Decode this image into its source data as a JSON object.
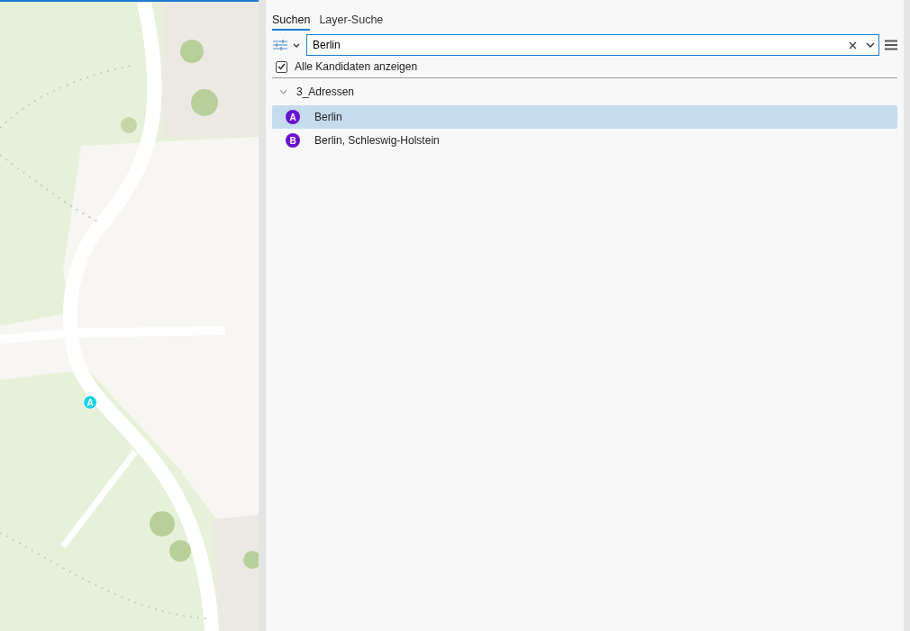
{
  "map": {
    "kind": "picture",
    "pin_label": "A"
  },
  "pane": {
    "tabs": [
      {
        "label": "Suchen",
        "selected": true
      },
      {
        "label": "Layer-Suche",
        "selected": false
      }
    ],
    "search": {
      "value": "Berlin"
    },
    "show_all": {
      "label": "Alle Kandidaten anzeigen",
      "checked": true
    },
    "group": {
      "label": "3_Adressen",
      "expanded": true,
      "results": [
        {
          "marker": "A",
          "label": "Berlin",
          "selected": true
        },
        {
          "marker": "B",
          "label": "Berlin, Schleswig-Holstein",
          "selected": false
        }
      ]
    }
  }
}
